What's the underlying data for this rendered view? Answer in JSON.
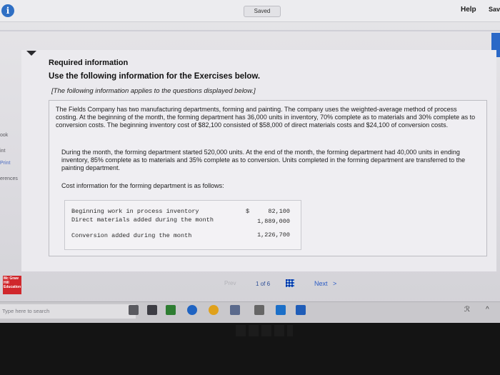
{
  "topbar": {
    "saved_label": "Saved",
    "help_label": "Help",
    "save_label": "Sav"
  },
  "left_rail": {
    "items": [
      "ook",
      "int",
      "Print",
      "erences"
    ]
  },
  "section": {
    "required_info": "Required information",
    "use_info": "Use the following information for the Exercises below.",
    "applies_note": "[The following information applies to the questions displayed below.]",
    "para1": "The Fields Company has two manufacturing departments, forming and painting. The company uses the weighted-average method of process costing. At the beginning of the month, the forming department has 36,000 units in inventory, 70% complete as to materials and 30% complete as to conversion costs. The beginning inventory cost of $82,100 consisted of $58,000 of direct materials costs and $24,100 of conversion costs.",
    "para2": "During the month, the forming department started 520,000 units. At the end of the month, the forming department had 40,000 units in ending inventory, 85% complete as to materials and 35% complete as to conversion. Units completed in the forming department are transferred to the painting department.",
    "para3": "Cost information for the forming department is as follows:"
  },
  "cost_table": {
    "currency": "$",
    "rows": [
      {
        "label": "Beginning work in process inventory",
        "amount": "82,100"
      },
      {
        "label": "Direct materials added during the month",
        "amount": "1,889,000"
      },
      {
        "label": "Conversion added during the month",
        "amount": "1,226,700"
      }
    ]
  },
  "nav": {
    "prev_label": "Prev",
    "page_current": "1",
    "page_of": "of",
    "page_total": "6",
    "next_label": "Next",
    "next_chevron": ">"
  },
  "logo": {
    "text": "Mc Graw Hill Education"
  },
  "taskbar": {
    "search_placeholder": "Type here to search"
  },
  "colors": {
    "accent_blue": "#2a68c7",
    "logo_red": "#d0272c"
  }
}
